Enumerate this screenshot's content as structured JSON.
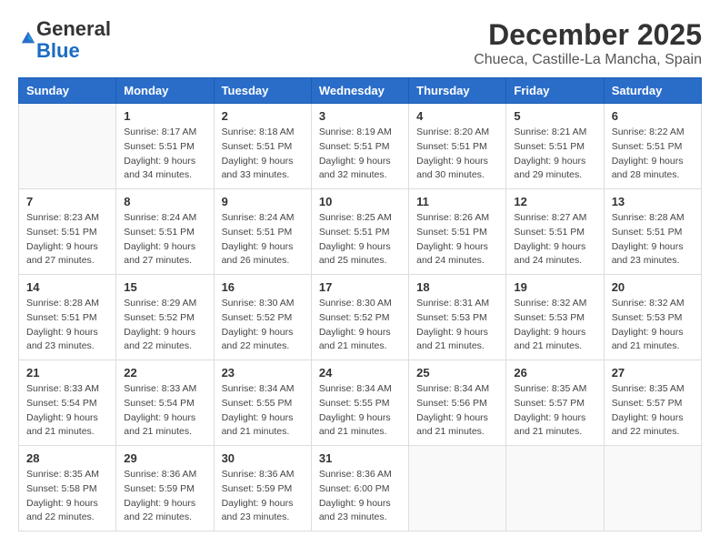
{
  "logo": {
    "general": "General",
    "blue": "Blue"
  },
  "header": {
    "month": "December 2025",
    "location": "Chueca, Castille-La Mancha, Spain"
  },
  "weekdays": [
    "Sunday",
    "Monday",
    "Tuesday",
    "Wednesday",
    "Thursday",
    "Friday",
    "Saturday"
  ],
  "weeks": [
    [
      {
        "day": "",
        "sunrise": "",
        "sunset": "",
        "daylight": ""
      },
      {
        "day": "1",
        "sunrise": "Sunrise: 8:17 AM",
        "sunset": "Sunset: 5:51 PM",
        "daylight": "Daylight: 9 hours and 34 minutes."
      },
      {
        "day": "2",
        "sunrise": "Sunrise: 8:18 AM",
        "sunset": "Sunset: 5:51 PM",
        "daylight": "Daylight: 9 hours and 33 minutes."
      },
      {
        "day": "3",
        "sunrise": "Sunrise: 8:19 AM",
        "sunset": "Sunset: 5:51 PM",
        "daylight": "Daylight: 9 hours and 32 minutes."
      },
      {
        "day": "4",
        "sunrise": "Sunrise: 8:20 AM",
        "sunset": "Sunset: 5:51 PM",
        "daylight": "Daylight: 9 hours and 30 minutes."
      },
      {
        "day": "5",
        "sunrise": "Sunrise: 8:21 AM",
        "sunset": "Sunset: 5:51 PM",
        "daylight": "Daylight: 9 hours and 29 minutes."
      },
      {
        "day": "6",
        "sunrise": "Sunrise: 8:22 AM",
        "sunset": "Sunset: 5:51 PM",
        "daylight": "Daylight: 9 hours and 28 minutes."
      }
    ],
    [
      {
        "day": "7",
        "sunrise": "Sunrise: 8:23 AM",
        "sunset": "Sunset: 5:51 PM",
        "daylight": "Daylight: 9 hours and 27 minutes."
      },
      {
        "day": "8",
        "sunrise": "Sunrise: 8:24 AM",
        "sunset": "Sunset: 5:51 PM",
        "daylight": "Daylight: 9 hours and 27 minutes."
      },
      {
        "day": "9",
        "sunrise": "Sunrise: 8:24 AM",
        "sunset": "Sunset: 5:51 PM",
        "daylight": "Daylight: 9 hours and 26 minutes."
      },
      {
        "day": "10",
        "sunrise": "Sunrise: 8:25 AM",
        "sunset": "Sunset: 5:51 PM",
        "daylight": "Daylight: 9 hours and 25 minutes."
      },
      {
        "day": "11",
        "sunrise": "Sunrise: 8:26 AM",
        "sunset": "Sunset: 5:51 PM",
        "daylight": "Daylight: 9 hours and 24 minutes."
      },
      {
        "day": "12",
        "sunrise": "Sunrise: 8:27 AM",
        "sunset": "Sunset: 5:51 PM",
        "daylight": "Daylight: 9 hours and 24 minutes."
      },
      {
        "day": "13",
        "sunrise": "Sunrise: 8:28 AM",
        "sunset": "Sunset: 5:51 PM",
        "daylight": "Daylight: 9 hours and 23 minutes."
      }
    ],
    [
      {
        "day": "14",
        "sunrise": "Sunrise: 8:28 AM",
        "sunset": "Sunset: 5:51 PM",
        "daylight": "Daylight: 9 hours and 23 minutes."
      },
      {
        "day": "15",
        "sunrise": "Sunrise: 8:29 AM",
        "sunset": "Sunset: 5:52 PM",
        "daylight": "Daylight: 9 hours and 22 minutes."
      },
      {
        "day": "16",
        "sunrise": "Sunrise: 8:30 AM",
        "sunset": "Sunset: 5:52 PM",
        "daylight": "Daylight: 9 hours and 22 minutes."
      },
      {
        "day": "17",
        "sunrise": "Sunrise: 8:30 AM",
        "sunset": "Sunset: 5:52 PM",
        "daylight": "Daylight: 9 hours and 21 minutes."
      },
      {
        "day": "18",
        "sunrise": "Sunrise: 8:31 AM",
        "sunset": "Sunset: 5:53 PM",
        "daylight": "Daylight: 9 hours and 21 minutes."
      },
      {
        "day": "19",
        "sunrise": "Sunrise: 8:32 AM",
        "sunset": "Sunset: 5:53 PM",
        "daylight": "Daylight: 9 hours and 21 minutes."
      },
      {
        "day": "20",
        "sunrise": "Sunrise: 8:32 AM",
        "sunset": "Sunset: 5:53 PM",
        "daylight": "Daylight: 9 hours and 21 minutes."
      }
    ],
    [
      {
        "day": "21",
        "sunrise": "Sunrise: 8:33 AM",
        "sunset": "Sunset: 5:54 PM",
        "daylight": "Daylight: 9 hours and 21 minutes."
      },
      {
        "day": "22",
        "sunrise": "Sunrise: 8:33 AM",
        "sunset": "Sunset: 5:54 PM",
        "daylight": "Daylight: 9 hours and 21 minutes."
      },
      {
        "day": "23",
        "sunrise": "Sunrise: 8:34 AM",
        "sunset": "Sunset: 5:55 PM",
        "daylight": "Daylight: 9 hours and 21 minutes."
      },
      {
        "day": "24",
        "sunrise": "Sunrise: 8:34 AM",
        "sunset": "Sunset: 5:55 PM",
        "daylight": "Daylight: 9 hours and 21 minutes."
      },
      {
        "day": "25",
        "sunrise": "Sunrise: 8:34 AM",
        "sunset": "Sunset: 5:56 PM",
        "daylight": "Daylight: 9 hours and 21 minutes."
      },
      {
        "day": "26",
        "sunrise": "Sunrise: 8:35 AM",
        "sunset": "Sunset: 5:57 PM",
        "daylight": "Daylight: 9 hours and 21 minutes."
      },
      {
        "day": "27",
        "sunrise": "Sunrise: 8:35 AM",
        "sunset": "Sunset: 5:57 PM",
        "daylight": "Daylight: 9 hours and 22 minutes."
      }
    ],
    [
      {
        "day": "28",
        "sunrise": "Sunrise: 8:35 AM",
        "sunset": "Sunset: 5:58 PM",
        "daylight": "Daylight: 9 hours and 22 minutes."
      },
      {
        "day": "29",
        "sunrise": "Sunrise: 8:36 AM",
        "sunset": "Sunset: 5:59 PM",
        "daylight": "Daylight: 9 hours and 22 minutes."
      },
      {
        "day": "30",
        "sunrise": "Sunrise: 8:36 AM",
        "sunset": "Sunset: 5:59 PM",
        "daylight": "Daylight: 9 hours and 23 minutes."
      },
      {
        "day": "31",
        "sunrise": "Sunrise: 8:36 AM",
        "sunset": "Sunset: 6:00 PM",
        "daylight": "Daylight: 9 hours and 23 minutes."
      },
      {
        "day": "",
        "sunrise": "",
        "sunset": "",
        "daylight": ""
      },
      {
        "day": "",
        "sunrise": "",
        "sunset": "",
        "daylight": ""
      },
      {
        "day": "",
        "sunrise": "",
        "sunset": "",
        "daylight": ""
      }
    ]
  ]
}
